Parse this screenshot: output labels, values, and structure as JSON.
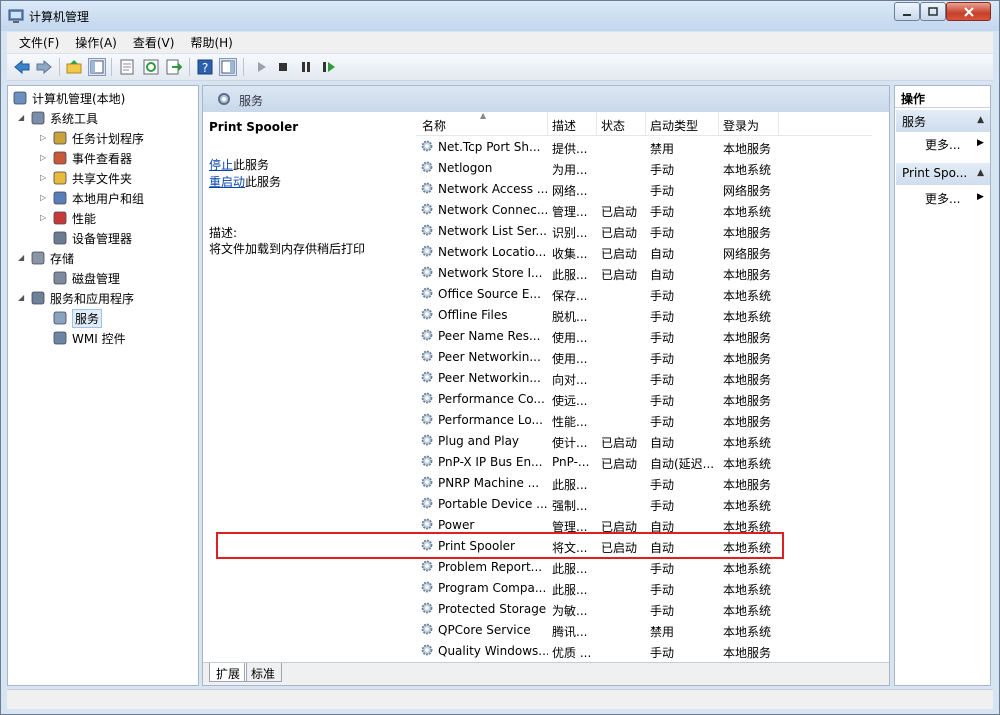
{
  "window": {
    "title": "计算机管理"
  },
  "menu": [
    "文件(F)",
    "操作(A)",
    "查看(V)",
    "帮助(H)"
  ],
  "toolbar_icons": [
    "back-arrow-icon",
    "forward-arrow-icon",
    "up-folder-icon",
    "show-hide-tree-icon",
    "properties-icon",
    "refresh-icon",
    "export-icon",
    "help-icon",
    "show-action-pane-icon",
    "play-icon",
    "stop-icon",
    "pause-icon",
    "restart-icon"
  ],
  "tree": [
    {
      "label": "计算机管理(本地)",
      "level": 0,
      "icon": "computer-management-icon"
    },
    {
      "label": "系统工具",
      "level": 1,
      "icon": "tools-icon"
    },
    {
      "label": "任务计划程序",
      "level": 2,
      "icon": "clock-icon"
    },
    {
      "label": "事件查看器",
      "level": 2,
      "icon": "event-viewer-icon"
    },
    {
      "label": "共享文件夹",
      "level": 2,
      "icon": "shared-folder-icon"
    },
    {
      "label": "本地用户和组",
      "level": 2,
      "icon": "users-icon"
    },
    {
      "label": "性能",
      "level": 2,
      "icon": "performance-icon"
    },
    {
      "label": "设备管理器",
      "level": 2,
      "icon": "device-manager-icon"
    },
    {
      "label": "存储",
      "level": 1,
      "icon": "storage-icon"
    },
    {
      "label": "磁盘管理",
      "level": 2,
      "icon": "disk-icon"
    },
    {
      "label": "服务和应用程序",
      "level": 1,
      "icon": "services-apps-icon"
    },
    {
      "label": "服务",
      "level": 2,
      "icon": "gear-icon"
    },
    {
      "label": "WMI 控件",
      "level": 2,
      "icon": "wmi-icon"
    }
  ],
  "center": {
    "header": "服务",
    "detail": {
      "service_name": "Print Spooler",
      "stop_link": "停止",
      "stop_suffix": "此服务",
      "restart_link": "重启动",
      "restart_suffix": "此服务",
      "desc_label": "描述:",
      "desc_text": "将文件加载到内存供稍后打印"
    },
    "columns": [
      "名称",
      "描述",
      "状态",
      "启动类型",
      "登录为"
    ],
    "rows": [
      [
        "Net.Tcp Port Sh...",
        "提供...",
        "",
        "禁用",
        "本地服务"
      ],
      [
        "Netlogon",
        "为用...",
        "",
        "手动",
        "本地系统"
      ],
      [
        "Network Access ...",
        "网络...",
        "",
        "手动",
        "网络服务"
      ],
      [
        "Network Connec...",
        "管理...",
        "已启动",
        "手动",
        "本地系统"
      ],
      [
        "Network List Ser...",
        "识别...",
        "已启动",
        "手动",
        "本地服务"
      ],
      [
        "Network Locatio...",
        "收集...",
        "已启动",
        "自动",
        "网络服务"
      ],
      [
        "Network Store I...",
        "此服...",
        "已启动",
        "自动",
        "本地服务"
      ],
      [
        "Office  Source E...",
        "保存...",
        "",
        "手动",
        "本地系统"
      ],
      [
        "Offline Files",
        "脱机...",
        "",
        "手动",
        "本地系统"
      ],
      [
        "Peer Name Res...",
        "使用...",
        "",
        "手动",
        "本地服务"
      ],
      [
        "Peer Networkin...",
        "使用...",
        "",
        "手动",
        "本地服务"
      ],
      [
        "Peer Networkin...",
        "向对...",
        "",
        "手动",
        "本地服务"
      ],
      [
        "Performance Co...",
        "使远...",
        "",
        "手动",
        "本地服务"
      ],
      [
        "Performance Lo...",
        "性能...",
        "",
        "手动",
        "本地服务"
      ],
      [
        "Plug and Play",
        "使计...",
        "已启动",
        "自动",
        "本地系统"
      ],
      [
        "PnP-X IP Bus En...",
        "PnP-...",
        "已启动",
        "自动(延迟...",
        "本地系统"
      ],
      [
        "PNRP Machine ...",
        "此服...",
        "",
        "手动",
        "本地服务"
      ],
      [
        "Portable Device ...",
        "强制...",
        "",
        "手动",
        "本地系统"
      ],
      [
        "Power",
        "管理...",
        "已启动",
        "自动",
        "本地系统"
      ],
      [
        "Print Spooler",
        "将文...",
        "已启动",
        "自动",
        "本地系统"
      ],
      [
        "Problem Report...",
        "此服...",
        "",
        "手动",
        "本地系统"
      ],
      [
        "Program Compa...",
        "此服...",
        "",
        "手动",
        "本地系统"
      ],
      [
        "Protected Storage",
        "为敏...",
        "",
        "手动",
        "本地系统"
      ],
      [
        "QPCore Service",
        "腾讯...",
        "",
        "禁用",
        "本地系统"
      ],
      [
        "Quality Windows...",
        "优质 ...",
        "",
        "手动",
        "本地服务"
      ]
    ],
    "highlighted_row_index": 19,
    "tabs": [
      "扩展",
      "标准"
    ]
  },
  "actions": {
    "title": "操作",
    "sections": [
      {
        "label": "服务",
        "more": "更多..."
      },
      {
        "label": "Print Spo...",
        "more": "更多..."
      }
    ]
  },
  "colors": {
    "highlight_box": "#e02020",
    "link": "#0645ad"
  }
}
